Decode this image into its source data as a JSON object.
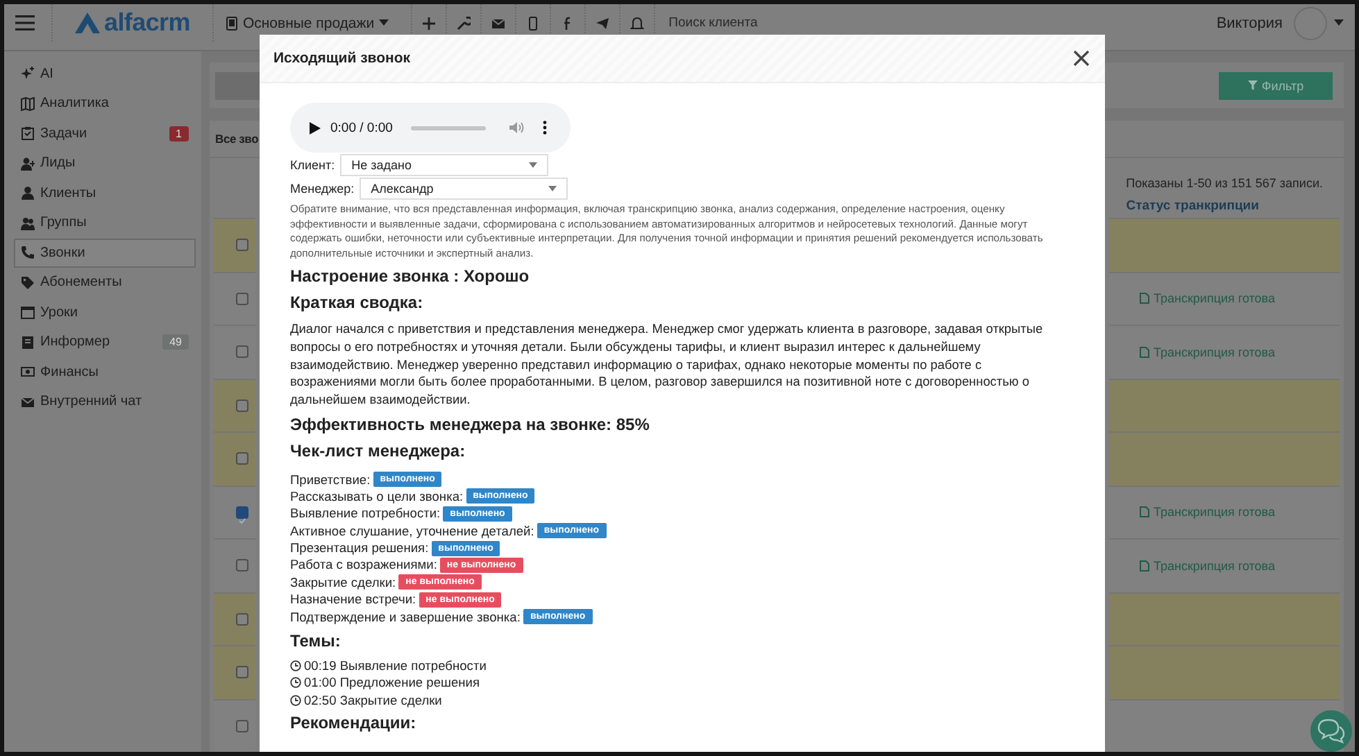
{
  "topbar": {
    "brand": "alfacrm",
    "pipeline": "Основные продажи",
    "search": {
      "placeholder": "Поиск клиента"
    },
    "user": "Виктория"
  },
  "sidebar": {
    "items": [
      {
        "label": "AI",
        "selected": false
      },
      {
        "label": "Аналитика",
        "selected": false
      },
      {
        "label": "Задачи",
        "selected": false,
        "badge": {
          "text": "1",
          "color": "#8a2a2e"
        }
      },
      {
        "label": "Лиды",
        "selected": false
      },
      {
        "label": "Клиенты",
        "selected": false
      },
      {
        "label": "Группы",
        "selected": false
      },
      {
        "label": "Звонки",
        "selected": true
      },
      {
        "label": "Абонементы",
        "selected": false
      },
      {
        "label": "Уроки",
        "selected": false
      },
      {
        "label": "Информер",
        "selected": false,
        "badge": {
          "text": "49",
          "color": "#6e7270"
        }
      },
      {
        "label": "Финансы",
        "selected": false
      },
      {
        "label": "Внутренний чат",
        "selected": false
      }
    ]
  },
  "panel": {
    "title": "Все зво",
    "filter_button": "Фильтр",
    "records": "Показаны 1-50 из 151 567 записи.",
    "columns": [
      "Статус транкрипции"
    ],
    "rows": [
      {
        "highlighted": true,
        "checked": false
      },
      {
        "highlighted": false,
        "checked": false,
        "status": "Транскрипция готова"
      },
      {
        "highlighted": false,
        "checked": false,
        "status": "Транскрипция готова"
      },
      {
        "highlighted": true,
        "checked": false
      },
      {
        "highlighted": true,
        "checked": false
      },
      {
        "highlighted": false,
        "checked": true,
        "status": "Транскрипция готова"
      },
      {
        "highlighted": false,
        "checked": false,
        "status": "Транскрипция готова"
      },
      {
        "highlighted": true,
        "checked": false
      },
      {
        "highlighted": true,
        "checked": false
      },
      {
        "highlighted": false,
        "checked": false
      }
    ]
  },
  "modal": {
    "title": "Исходящий звонок",
    "player": {
      "time": "0:00 / 0:00"
    },
    "fields": [
      {
        "label": "Клиент:",
        "value": "Не задано"
      },
      {
        "label": "Менеджер:",
        "value": "Александр"
      }
    ],
    "disclaimer": "Обратите внимание, что вся представленная информация, включая транскрипцию звонка, анализ содержания, определение настроения, оценку эффективности и выявленные задачи, сформирована с использованием автоматизированных алгоритмов и нейросетевых технологий. Данные могут содержать ошибки, неточности или субъективные интерпретации. Для получения точной информации и принятия решений рекомендуется использовать дополнительные источники и экспертный анализ.",
    "mood": "Настроение звонка : Хорошо",
    "summary_title": "Краткая сводка:",
    "summary": "Диалог начался с приветствия и представления менеджера. Менеджер смог удержать клиента в разговоре, задавая открытые вопросы о его потребностях и уточняя детали. Были обсуждены тарифы, и клиент выразил интерес к дальнейшему взаимодействию. Менеджер уверенно представил информацию о тарифах, однако некоторые моменты по работе с возражениями могли быть более проработанными. В целом, разговор завершился на позитивной ноте с договоренностью о дальнейшем взаимодействии.",
    "efficiency": "Эффективность менеджера на звонке: 85%",
    "checklist_title": "Чек-лист менеджера:",
    "checklist": [
      {
        "label": "Приветствие:",
        "status": "выполнено",
        "done": true
      },
      {
        "label": "Рассказывать о цели звонка:",
        "status": "выполнено",
        "done": true
      },
      {
        "label": "Выявление потребности:",
        "status": "выполнено",
        "done": true
      },
      {
        "label": "Активное слушание, уточнение деталей:",
        "status": "выполнено",
        "done": true
      },
      {
        "label": "Презентация решения:",
        "status": "выполнено",
        "done": true
      },
      {
        "label": "Работа с возражениями:",
        "status": "не выполнено",
        "done": false
      },
      {
        "label": "Закрытие сделки:",
        "status": "не выполнено",
        "done": false
      },
      {
        "label": "Назначение встречи:",
        "status": "не выполнено",
        "done": false
      },
      {
        "label": "Подтверждение и завершение звонка:",
        "status": "выполнено",
        "done": true
      }
    ],
    "topics_title": "Темы:",
    "topics": [
      "00:19 Выявление потребности",
      "01:00 Предложение решения",
      "02:50 Закрытие сделки"
    ],
    "recommendations_title": "Рекомендации:"
  }
}
